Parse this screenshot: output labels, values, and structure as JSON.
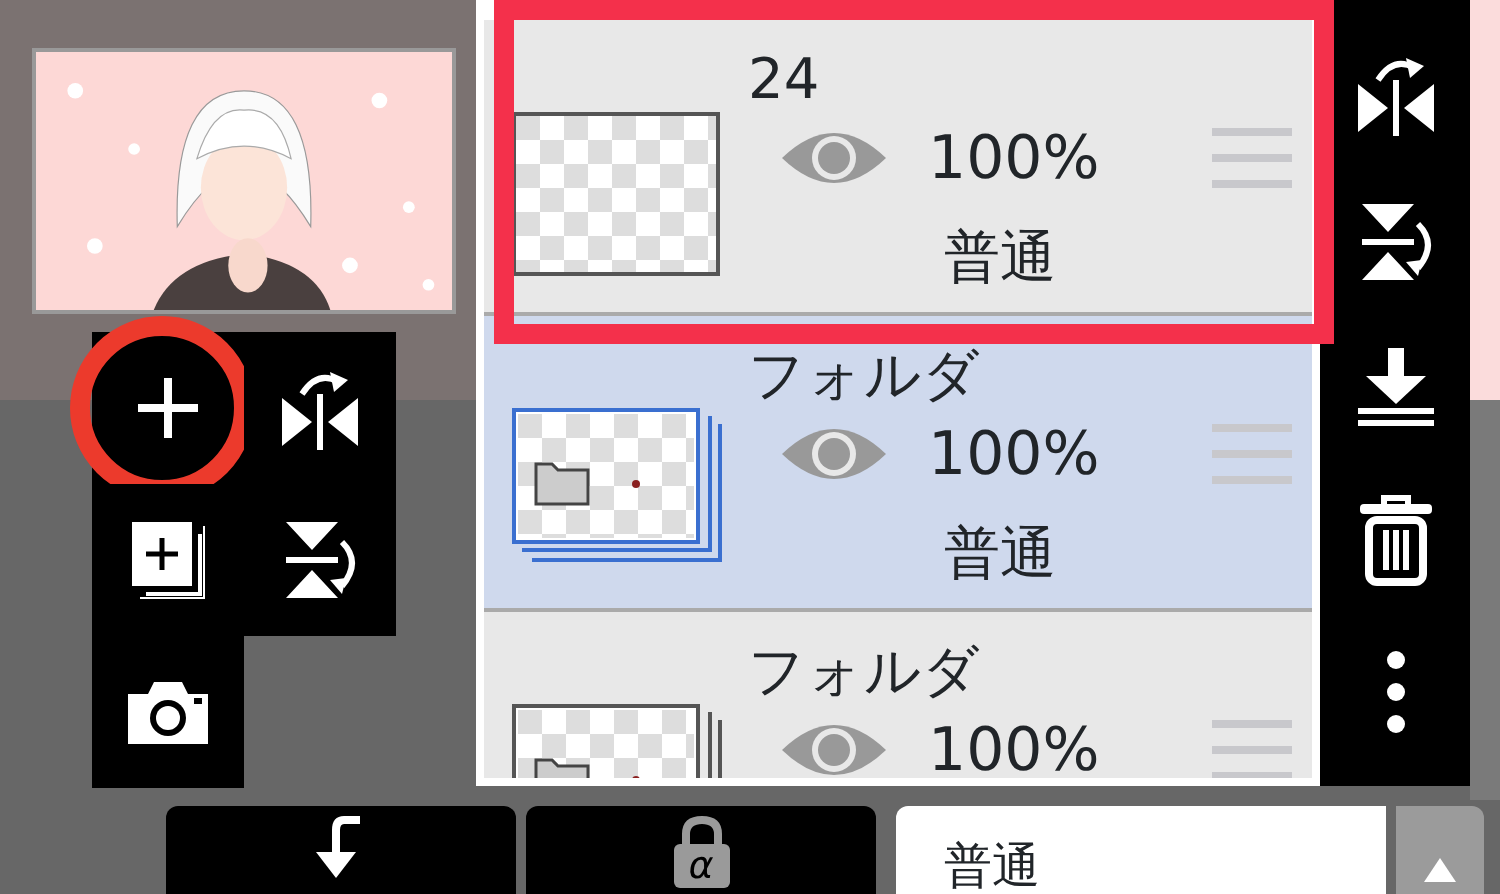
{
  "tools": [
    {
      "kind": "add",
      "highlighted": true
    },
    {
      "kind": "flip-h",
      "highlighted": false
    },
    {
      "kind": "duplicate",
      "highlighted": false
    },
    {
      "kind": "flip-v",
      "highlighted": false
    },
    {
      "kind": "camera",
      "highlighted": false
    }
  ],
  "layers": [
    {
      "kind": "layer",
      "name": "24",
      "visible": true,
      "opacity": "100%",
      "blend": "普通",
      "selected": false,
      "highlighted": true
    },
    {
      "kind": "folder",
      "name": "フォルダ",
      "visible": true,
      "opacity": "100%",
      "blend": "普通",
      "selected": true,
      "highlighted": false
    },
    {
      "kind": "folder",
      "name": "フォルダ",
      "visible": true,
      "opacity": "100%",
      "selected": false,
      "highlighted": false
    }
  ],
  "side_tools": [
    {
      "kind": "flip-h"
    },
    {
      "kind": "flip-v"
    },
    {
      "kind": "merge-down"
    },
    {
      "kind": "trash"
    },
    {
      "kind": "more"
    }
  ],
  "bottom": {
    "alpha_lock": {
      "label": "α"
    },
    "blend_mode": {
      "value": "普通"
    }
  }
}
